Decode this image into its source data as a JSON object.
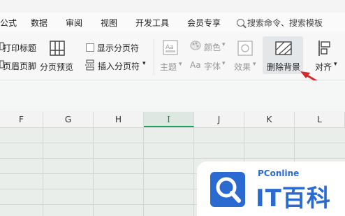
{
  "menu": {
    "items": [
      "公式",
      "数据",
      "审阅",
      "视图",
      "开发工具",
      "会员专享"
    ],
    "search_label": "搜索命令、搜索模板"
  },
  "ribbon": {
    "print_titles": "打印标题",
    "header_footer": "页眉页脚",
    "page_break_preview": "分页预览",
    "show_page_breaks": "显示分页符",
    "insert_page_break": "插入分页符",
    "theme": "主题",
    "color": "颜色",
    "font": "字体",
    "effects": "效果",
    "delete_background": "删除背景",
    "align": "对齐"
  },
  "columns": [
    "F",
    "G",
    "H",
    "I",
    "J",
    "K",
    "L"
  ],
  "selected_column": "I",
  "logo": {
    "small": "PConline",
    "big": "IT百科"
  },
  "colors": {
    "accent_green": "#1f9e5c",
    "arrow_red": "#d9262b",
    "brand_blue": "#2a6ad1"
  }
}
